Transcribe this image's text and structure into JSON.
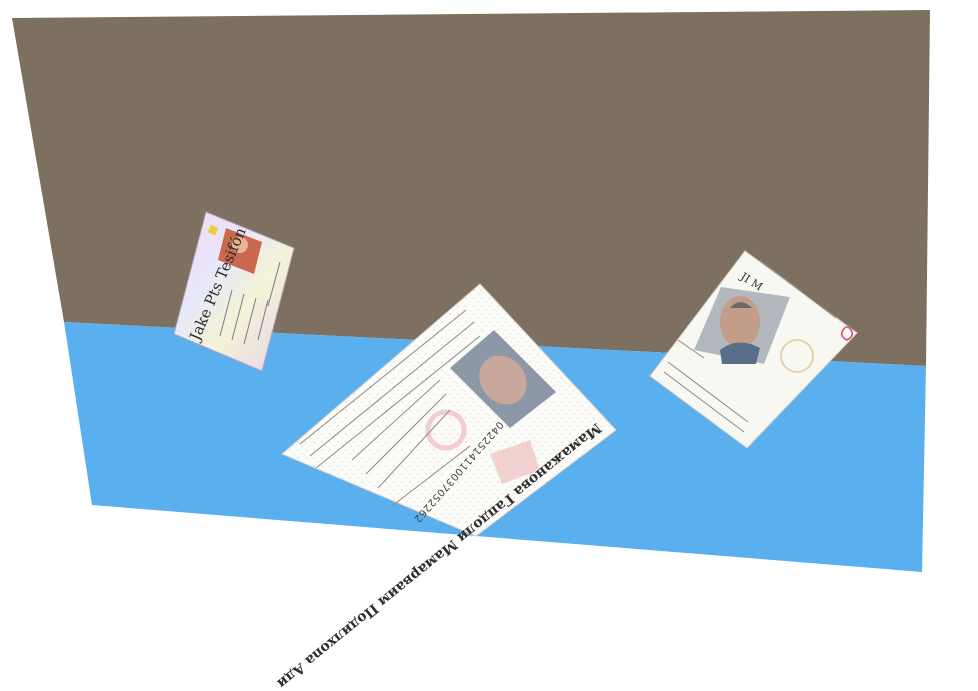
{
  "scene": {
    "wall_color": "#7e7060",
    "floor_color": "#5aafef",
    "backdrop_color": "#ffffff"
  },
  "cards": [
    {
      "id": "card-1",
      "name_text": "Jake Pts Tesifón",
      "card_color": "#e8d6e8"
    },
    {
      "id": "card-2",
      "name_text": "Мамажанова Гапдоли Мамарваим Подилхоnа Ади",
      "number_text": "0422514110037052262",
      "card_color": "#fbfbf8"
    },
    {
      "id": "card-3",
      "header_text": "JI M",
      "card_color": "#f8f8f2"
    }
  ]
}
